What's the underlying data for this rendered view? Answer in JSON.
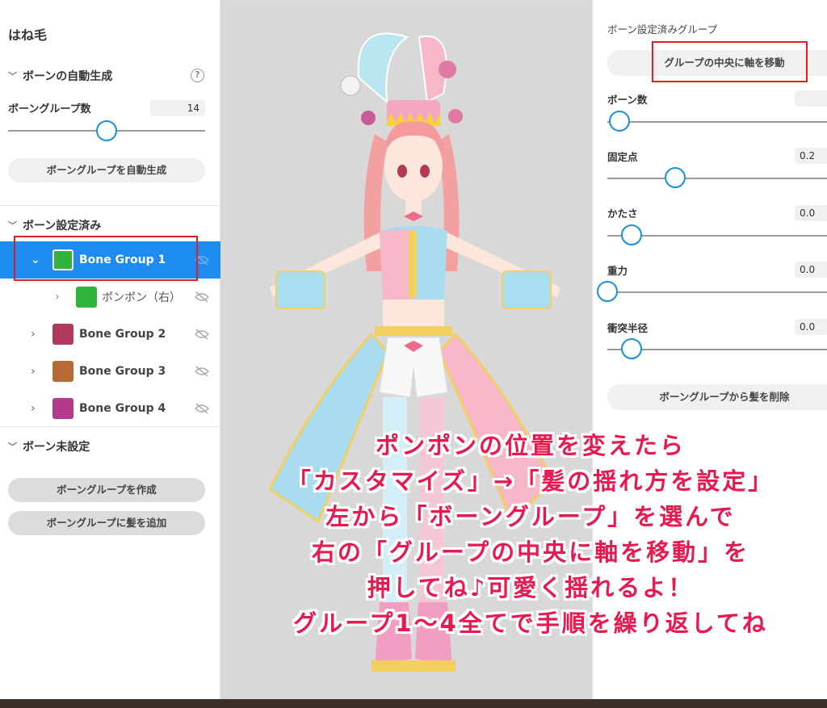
{
  "left_panel": {
    "title": "はね毛",
    "auto_section": {
      "heading": "ボーンの自動生成",
      "help_icon": "question-circle-icon",
      "count_label": "ボーングループ数",
      "count_value": "14",
      "slider_fraction": 0.5,
      "generate_button": "ボーングループを自動生成"
    },
    "configured_section": {
      "heading": "ボーン設定済み",
      "groups": [
        {
          "name": "Bone Group 1",
          "color": "#2fb33c",
          "expanded": true,
          "selected": true
        },
        {
          "name": "ポンポン（右）",
          "color": "#2fb33c",
          "child": true
        },
        {
          "name": "Bone Group 2",
          "color": "#b13a5c"
        },
        {
          "name": "Bone Group 3",
          "color": "#b86a36"
        },
        {
          "name": "Bone Group 4",
          "color": "#b33a8c"
        }
      ]
    },
    "unset_section": {
      "heading": "ボーン未設定",
      "create_button": "ボーングループを作成",
      "add_hair_button": "ボーングループに髪を追加"
    }
  },
  "right_panel": {
    "heading": "ボーン設定済みグループ",
    "move_axis_button": "グループの中央に軸を移動",
    "params": [
      {
        "label": "ボーン数",
        "value": "",
        "fraction": 0.05
      },
      {
        "label": "固定点",
        "value": "0.2",
        "fraction": 0.28
      },
      {
        "label": "かたさ",
        "value": "0.0",
        "fraction": 0.1
      },
      {
        "label": "重力",
        "value": "0.0",
        "fraction": 0.0
      },
      {
        "label": "衝突半径",
        "value": "0.0",
        "fraction": 0.1
      }
    ],
    "remove_hair_button": "ボーングループから髪を削除"
  },
  "caption": {
    "lines": [
      "ポンポンの位置を変えたら",
      "「カスタマイズ」→「髪の揺れ方を設定」",
      "左から「ボーングループ」を選んで",
      "右の「グループの中央に軸を移動」を",
      "押してね♪可愛く揺れるよ！",
      "グループ1～4全てで手順を繰り返してね"
    ]
  },
  "colors": {
    "accent": "#1d8bf0",
    "highlight_box": "#e02020",
    "caption_text": "#e8194f"
  }
}
